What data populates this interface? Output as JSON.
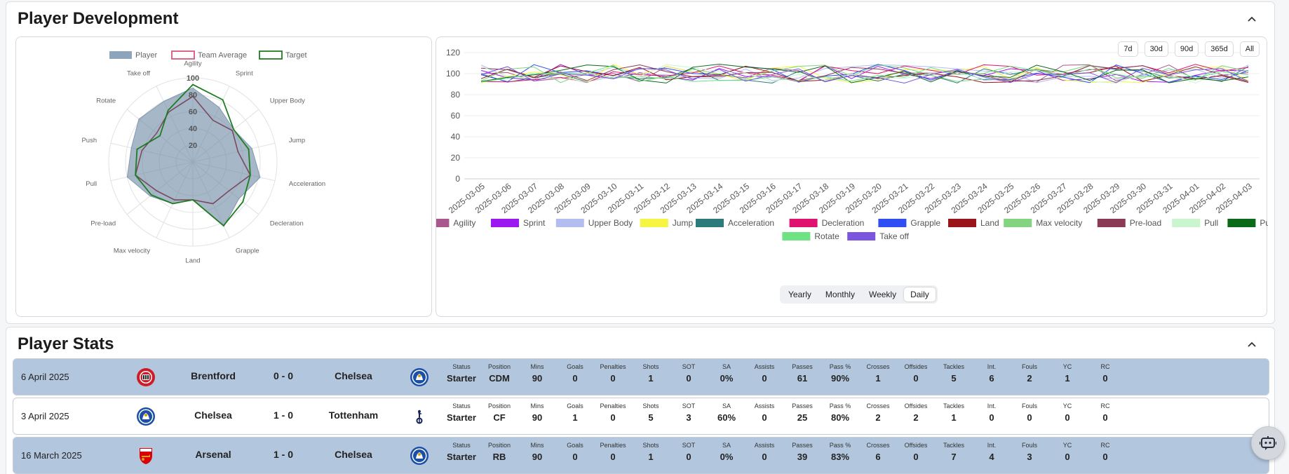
{
  "player_development": {
    "title": "Player Development",
    "radar": {
      "legend": [
        {
          "label": "Player",
          "color": "#8ea4bb"
        },
        {
          "label": "Team Average",
          "color": "#d6587a"
        },
        {
          "label": "Target",
          "color": "#1e7d22"
        }
      ],
      "axes": [
        "Agility",
        "Sprint",
        "Upper Body",
        "Jump",
        "Acceleration",
        "Decleration",
        "Grapple",
        "Land",
        "Max velocity",
        "Pre-load",
        "Pull",
        "Push",
        "Rotate",
        "Take off"
      ],
      "ticks": [
        "20",
        "40",
        "60",
        "80",
        "100"
      ],
      "max": 100,
      "player": [
        88,
        72,
        62,
        72,
        82,
        70,
        85,
        45,
        55,
        65,
        80,
        75,
        82,
        80
      ],
      "team_average": [
        78,
        55,
        60,
        55,
        70,
        55,
        55,
        45,
        50,
        55,
        70,
        62,
        55,
        66
      ],
      "target": [
        92,
        82,
        62,
        68,
        70,
        76,
        84,
        45,
        55,
        63,
        70,
        68,
        50,
        68
      ]
    },
    "timeline": {
      "range_buttons": [
        "7d",
        "30d",
        "90d",
        "365d",
        "All"
      ],
      "y_ticks": [
        "0",
        "20",
        "40",
        "60",
        "80",
        "100",
        "120"
      ],
      "dates": [
        "2025-03-05",
        "2025-03-06",
        "2025-03-07",
        "2025-03-08",
        "2025-03-09",
        "2025-03-10",
        "2025-03-11",
        "2025-03-12",
        "2025-03-13",
        "2025-03-14",
        "2025-03-15",
        "2025-03-16",
        "2025-03-17",
        "2025-03-18",
        "2025-03-19",
        "2025-03-20",
        "2025-03-21",
        "2025-03-22",
        "2025-03-23",
        "2025-03-24",
        "2025-03-25",
        "2025-03-26",
        "2025-03-27",
        "2025-03-28",
        "2025-03-29",
        "2025-03-30",
        "2025-03-31",
        "2025-04-01",
        "2025-04-02",
        "2025-04-03"
      ],
      "series": [
        {
          "name": "Agility",
          "color": "#a8588f"
        },
        {
          "name": "Sprint",
          "color": "#9b19f0"
        },
        {
          "name": "Upper Body",
          "color": "#b3bdf0"
        },
        {
          "name": "Jump",
          "color": "#f5f542"
        },
        {
          "name": "Acceleration",
          "color": "#2d7a7c"
        },
        {
          "name": "Decleration",
          "color": "#e0126f"
        },
        {
          "name": "Grapple",
          "color": "#2f4ff5"
        },
        {
          "name": "Land",
          "color": "#9a1519"
        },
        {
          "name": "Max velocity",
          "color": "#82d480"
        },
        {
          "name": "Pre-load",
          "color": "#8b3a55"
        },
        {
          "name": "Pull",
          "color": "#c9f5cf"
        },
        {
          "name": "Push",
          "color": "#0b6a17"
        },
        {
          "name": "Rotate",
          "color": "#6fe283"
        },
        {
          "name": "Take off",
          "color": "#7c55df"
        }
      ],
      "periods": [
        "Yearly",
        "Monthly",
        "Weekly",
        "Daily"
      ],
      "active_period": "Daily"
    }
  },
  "player_stats": {
    "title": "Player Stats",
    "headers": [
      "Status",
      "Position",
      "Mins",
      "Goals",
      "Penalties",
      "Shots",
      "SOT",
      "SA",
      "Assists",
      "Passes",
      "Pass %",
      "Crosses",
      "Offsides",
      "Tackles",
      "Int.",
      "Fouls",
      "YC",
      "RC"
    ],
    "matches": [
      {
        "date": "6 April 2025",
        "home": "Brentford",
        "home_logo": "brentford-crest",
        "score": "0 - 0",
        "away": "Chelsea",
        "away_logo": "chelsea-crest",
        "highlight": true,
        "values": [
          "Starter",
          "CDM",
          "90",
          "0",
          "0",
          "1",
          "0",
          "0%",
          "0",
          "61",
          "90%",
          "1",
          "0",
          "5",
          "6",
          "2",
          "1",
          "0"
        ]
      },
      {
        "date": "3 April 2025",
        "home": "Chelsea",
        "home_logo": "chelsea-crest",
        "score": "1 - 0",
        "away": "Tottenham",
        "away_logo": "tottenham-crest",
        "highlight": false,
        "values": [
          "Starter",
          "CF",
          "90",
          "1",
          "0",
          "5",
          "3",
          "60%",
          "0",
          "25",
          "80%",
          "2",
          "2",
          "1",
          "0",
          "0",
          "0",
          "0"
        ]
      },
      {
        "date": "16 March 2025",
        "home": "Arsenal",
        "home_logo": "arsenal-crest",
        "score": "1 - 0",
        "away": "Chelsea",
        "away_logo": "chelsea-crest",
        "highlight": true,
        "values": [
          "Starter",
          "RB",
          "90",
          "0",
          "0",
          "1",
          "0",
          "0%",
          "0",
          "39",
          "83%",
          "6",
          "0",
          "7",
          "4",
          "3",
          "0",
          "0"
        ]
      }
    ]
  },
  "colors": {
    "row_highlight": "#b2c6dd",
    "accent": "#2d6bd1"
  }
}
